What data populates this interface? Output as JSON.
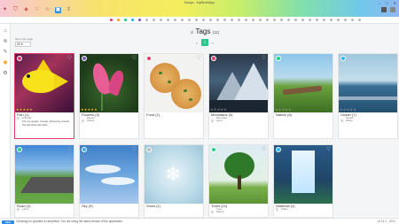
{
  "app": {
    "title": "Mango - MyMediaApp",
    "window_controls": [
      "–",
      "□",
      "✕"
    ]
  },
  "toolbar": {
    "left_icons": [
      "wand-icon",
      "filter-icon",
      "tag-icon",
      "heart-icon",
      "star-icon",
      "image-icon",
      "upload-icon"
    ]
  },
  "filter_colors": [
    "#e53c6a",
    "#ff9f1c",
    "#1ccf88",
    "#29b6f6",
    "#7e57c2",
    "#bdbdbd",
    "#bdbdbd",
    "#bdbdbd",
    "#bdbdbd",
    "#bdbdbd",
    "#bdbdbd",
    "#bdbdbd",
    "#bdbdbd",
    "#bdbdbd",
    "#bdbdbd",
    "#bdbdbd",
    "#bdbdbd",
    "#bdbdbd",
    "#bdbdbd",
    "#bdbdbd",
    "#bdbdbd",
    "#bdbdbd",
    "#bdbdbd",
    "#bdbdbd",
    "#bdbdbd",
    "#bdbdbd",
    "#bdbdbd",
    "#bdbdbd",
    "#bdbdbd",
    "#bdbdbd",
    "#bdbdbd",
    "#bdbdbd",
    "#bdbdbd",
    "#bdbdbd",
    "#bdbdbd",
    "#bdbdbd"
  ],
  "sidebar": {
    "items": [
      "home-icon",
      "layers-icon",
      "compass-icon",
      "tag-icon",
      "settings-icon"
    ]
  },
  "page": {
    "title": "Tags",
    "count": "(11)",
    "sort_label": "Items per page",
    "sort_value": "20",
    "pager_prev": "«",
    "pager_current": "1",
    "pager_next": "»"
  },
  "cards": [
    {
      "label": "Fish (1)",
      "color": "#e53c6a",
      "sub": "Animals",
      "desc": "Fish are aquatic, craniate, gill-bearing animals that lack limbs with digits.",
      "stars": 5,
      "selected": true
    },
    {
      "label": "Flowers (3)",
      "color": "#7e57c2",
      "sub": "Plants",
      "super": "Flower",
      "stars": 5
    },
    {
      "label": "Food (1)",
      "color": "#e53c6a",
      "stars": 0
    },
    {
      "label": "Mountains (3)",
      "color": "#e53c6a",
      "sub": "Land",
      "super": "Mountain",
      "stars": 5
    },
    {
      "label": "Nature (6)",
      "color": "#1ccf88",
      "stars": 0
    },
    {
      "label": "Ocean (7)",
      "color": "#29b6f6",
      "sub": "Water",
      "super": "Ocean",
      "stars": 0
    },
    {
      "label": "Road (3)",
      "color": "#1ccf88",
      "sub": "Land",
      "stars": 0
    },
    {
      "label": "Sky (9)",
      "color": "#29b6f6",
      "stars": 0
    },
    {
      "label": "Snow (1)",
      "color": "#bdbdbd",
      "stars": 0
    },
    {
      "label": "Trees (10)",
      "color": "#1ccf88",
      "sub": "Plants",
      "super": "Tree",
      "stars": 0
    },
    {
      "label": "Waterfall (3)",
      "color": "#29b6f6",
      "sub": "Water",
      "stars": 0
    }
  ],
  "status": {
    "badge": "NEW",
    "message": "Checking for updates is completed. You are using the latest version of the application.",
    "right": "v0.14.1 · 2021"
  }
}
